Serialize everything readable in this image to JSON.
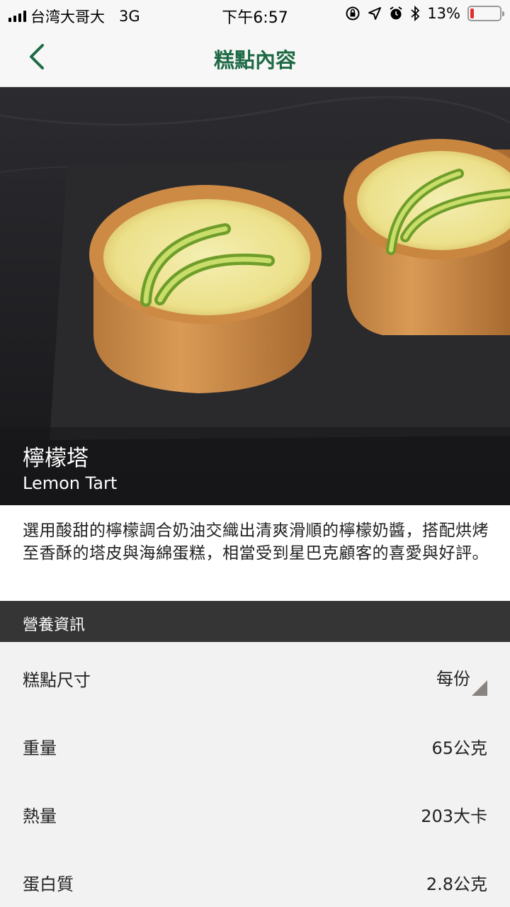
{
  "status": {
    "carrier": "台湾大哥大",
    "network": "3G",
    "time": "下午6:57",
    "battery_pct": "13%",
    "battery_level": 0.13
  },
  "nav": {
    "title": "糕點內容"
  },
  "product": {
    "name_zh": "檸檬塔",
    "name_en": "Lemon Tart",
    "description": "選用酸甜的檸檬調合奶油交織出清爽滑順的檸檬奶醬，搭配烘烤至香酥的塔皮與海綿蛋糕，相當受到星巴克顧客的喜愛與好評。"
  },
  "nutrition": {
    "header": "營養資訊",
    "size_label": "糕點尺寸",
    "size_value": "每份",
    "rows": [
      {
        "label": "重量",
        "value": "65公克"
      },
      {
        "label": "熱量",
        "value": "203大卡"
      },
      {
        "label": "蛋白質",
        "value": "2.8公克"
      }
    ]
  },
  "colors": {
    "brand": "#1e6a45",
    "section_bg": "#353535"
  }
}
